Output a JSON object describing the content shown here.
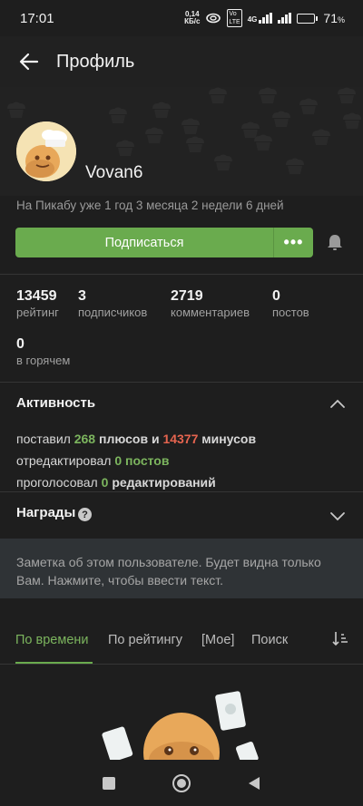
{
  "status": {
    "time": "17:01",
    "speed_top": "0,14",
    "speed_bottom": "КБ/с",
    "vo_top": "Vo",
    "vo_bottom": "LTE",
    "network": "4G",
    "battery_value": "71",
    "battery_unit": "%",
    "battery_level": 0.71
  },
  "header": {
    "title": "Профиль"
  },
  "profile": {
    "username": "Vovan6",
    "since": "На Пикабу уже 1 год 3 месяца 2 недели 6 дней",
    "subscribe_label": "Подписаться",
    "more_label": "•••"
  },
  "stats": [
    {
      "value": "13459",
      "label": "рейтинг"
    },
    {
      "value": "3",
      "label": "подписчиков"
    },
    {
      "value": "2719",
      "label": "комментариев"
    },
    {
      "value": "0",
      "label": "постов"
    },
    {
      "value": "0",
      "label": "в горячем"
    }
  ],
  "activity": {
    "title": "Активность",
    "line1": {
      "prefix": "поставил",
      "pluses": "268",
      "mid": "плюсов и",
      "minuses": "14377",
      "suffix": "минусов"
    },
    "line2": {
      "prefix": "отредактировал",
      "count": "0",
      "suffix": "постов"
    },
    "line3": {
      "prefix": "проголосовал",
      "count": "0",
      "suffix": "редактирований"
    }
  },
  "awards": {
    "title": "Награды",
    "help": "?"
  },
  "note": {
    "text": "Заметка об этом пользователе. Будет видна только Вам. Нажмите, чтобы ввести текст."
  },
  "tabs": [
    {
      "label": "По времени",
      "active": true
    },
    {
      "label": "По рейтингу",
      "active": false
    },
    {
      "label": "[Мое]",
      "active": false
    },
    {
      "label": "Поиск",
      "active": false
    }
  ],
  "colors": {
    "accent": "#6aab4e",
    "accent_text": "#7cb55e",
    "minus": "#e5644f",
    "background": "#1e1e1e",
    "note_bg": "#2f3336"
  },
  "icons": [
    "back-arrow-icon",
    "bell-icon",
    "chevron-up-icon",
    "chevron-down-icon",
    "help-icon",
    "sort-icon",
    "nav-square-icon",
    "nav-home-icon",
    "nav-back-icon"
  ]
}
